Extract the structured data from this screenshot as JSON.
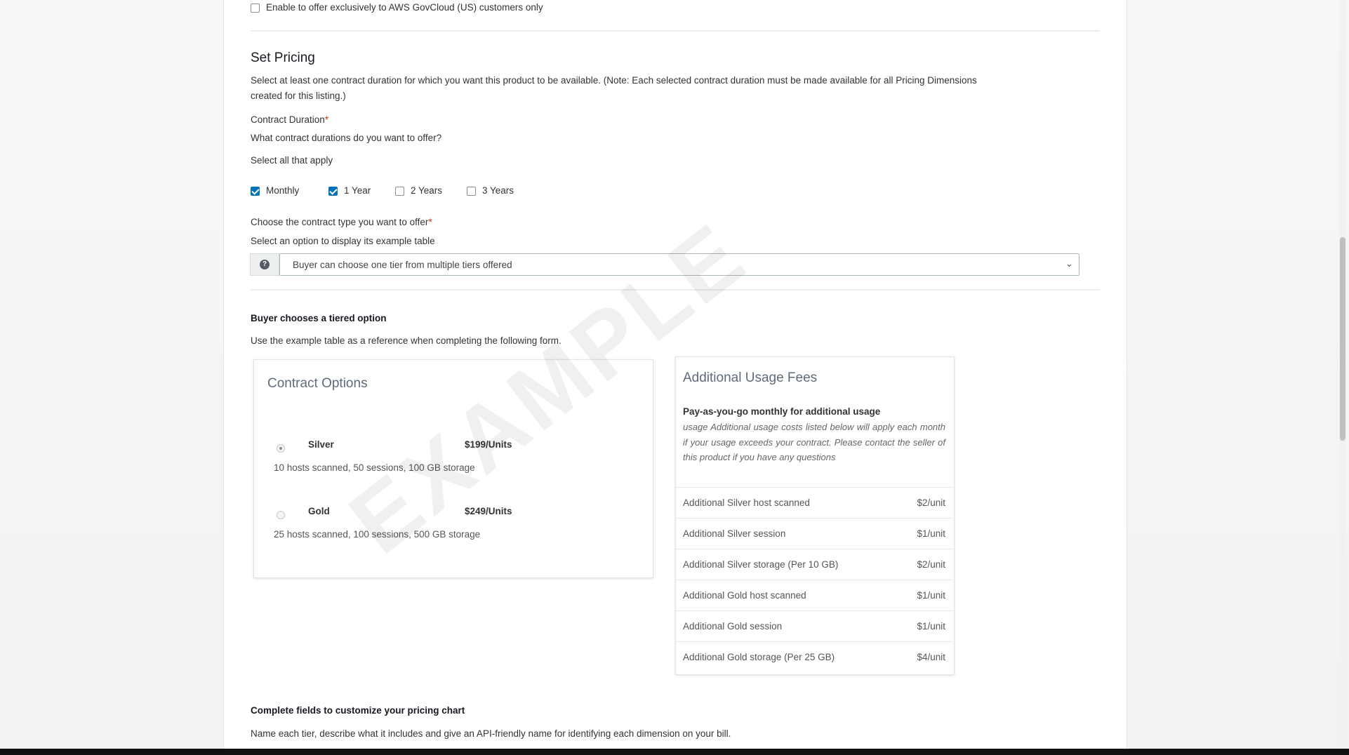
{
  "govcloud_checkbox": {
    "label": "Enable to offer exclusively to AWS GovCloud (US) customers only",
    "checked": false
  },
  "pricing": {
    "title": "Set Pricing",
    "intro_line1": "Select at least one contract duration for which you want this product to be available. (Note: Each selected contract duration must be made available for all Pricing Dimensions",
    "intro_line2": "created for this listing.)",
    "contract_duration_label": "Contract Duration",
    "required_mark": "*",
    "durations_question": "What contract durations do you want to offer?",
    "select_all_hint": "Select all that apply",
    "durations": [
      {
        "label": "Monthly",
        "checked": true
      },
      {
        "label": "1 Year",
        "checked": true
      },
      {
        "label": "2 Years",
        "checked": false
      },
      {
        "label": "3 Years",
        "checked": false
      }
    ],
    "contract_type_label": "Choose the contract type you want to offer",
    "contract_type_hint": "Select an option to display its example table",
    "contract_type_selected": "Buyer can choose one tier from multiple tiers offered",
    "info_icon": "info-icon"
  },
  "tiered": {
    "heading": "Buyer chooses a tiered option",
    "description": "Use the example table as a reference when completing the following form.",
    "watermark": "EXAMPLE"
  },
  "contract_options": {
    "title": "Contract Options",
    "tiers": [
      {
        "name": "Silver",
        "price": "$199/Units",
        "details": "10 hosts scanned, 50 sessions, 100 GB storage",
        "selected": true
      },
      {
        "name": "Gold",
        "price": "$249/Units",
        "details": "25 hosts scanned, 100 sessions, 500 GB storage",
        "selected": false
      }
    ]
  },
  "usage_fees": {
    "title": "Additional Usage Fees",
    "payg_heading": "Pay-as-you-go monthly for additional usage",
    "payg_text": "usage Additional usage costs listed below will apply each month if your usage exceeds your contract. Please contact the seller of this product if you have any questions",
    "rows": [
      {
        "name": "Additional Silver host scanned",
        "price": "$2/unit"
      },
      {
        "name": "Additional Silver session",
        "price": "$1/unit"
      },
      {
        "name": "Additional Silver storage (Per 10 GB)",
        "price": "$2/unit"
      },
      {
        "name": "Additional Gold host scanned",
        "price": "$1/unit"
      },
      {
        "name": "Additional Gold session",
        "price": "$1/unit"
      },
      {
        "name": "Additional Gold storage (Per 25 GB)",
        "price": "$4/unit"
      }
    ]
  },
  "customize": {
    "heading": "Complete fields to customize your pricing chart",
    "description": "Name each tier, describe what it includes and give an API-friendly name for identifying each dimension on your bill."
  },
  "colors": {
    "accent": "#0073bb",
    "required": "#d13212",
    "text": "#16191f"
  }
}
